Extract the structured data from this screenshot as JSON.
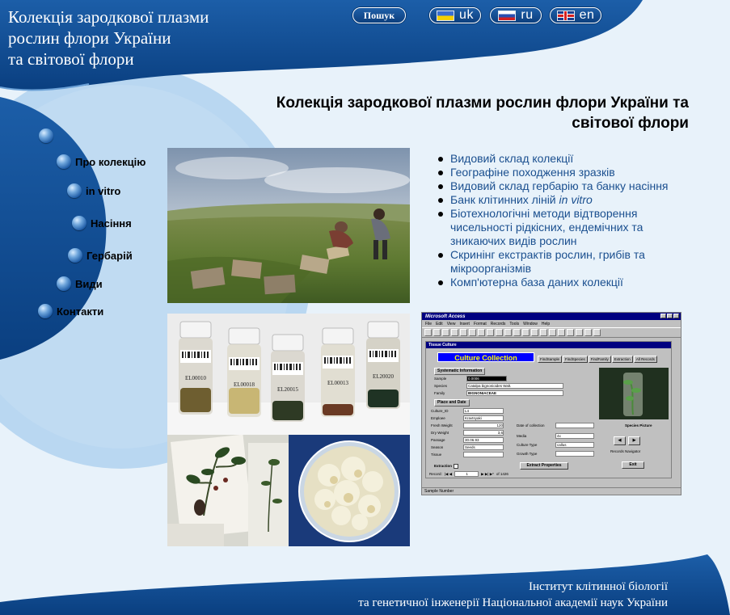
{
  "header": {
    "title_lines": [
      "Колекція зародкової плазми",
      "рослин флори України",
      "та світової флори"
    ],
    "search_label": "Пошук",
    "languages": [
      {
        "code_label": "uk",
        "flag": "ukraine-flag-icon"
      },
      {
        "code_label": "ru",
        "flag": "russia-flag-icon"
      },
      {
        "code_label": "en",
        "flag": "uk-flag-icon"
      }
    ]
  },
  "main": {
    "heading_line1": "Колекція зародкової плазми рослин флори України та",
    "heading_line2": "світової флори"
  },
  "nav": {
    "items": [
      {
        "label": ""
      },
      {
        "label": "Про колекцію"
      },
      {
        "label": "in vitro"
      },
      {
        "label": "Насіння"
      },
      {
        "label": "Гербарій"
      },
      {
        "label": "Види"
      },
      {
        "label": "Контакти"
      }
    ]
  },
  "features": {
    "items": [
      "Видовий склад колекції",
      "Географіне походження зразків",
      "Видовий склад гербарію та банку насіння",
      "Банк клітинних ліній ",
      "Біотехнологічні методи відтворення чисельності рідкісних, ендемічних та зникаючих видів рослин",
      "Скринінг екстрактів рослин, грибів та мікроорганізмів",
      "Комп'ютерна база даних колекції"
    ],
    "item4_italic": "in vitro"
  },
  "images": {
    "vial_labels": [
      "EL00010",
      "EL00018",
      "EL20015",
      "EL00013",
      "EL20020"
    ]
  },
  "access_window": {
    "title": "Microsoft Access",
    "menu": [
      "File",
      "Edit",
      "View",
      "Insert",
      "Format",
      "Records",
      "Tools",
      "Window",
      "Help"
    ],
    "form_title": "Tissue Culture",
    "header_label": "Culture Collection",
    "tabs": [
      "FindSample",
      "FindSpecies",
      "FindFamily",
      "Extraction",
      "All Records"
    ],
    "section_systematic": "Systematic Information",
    "section_place": "Place and Date",
    "fields": {
      "sample_label": "Sample",
      "sample_value": "0.0006",
      "species_label": "Species",
      "species_value": "Catalpa bignonioides Walt.",
      "family_label": "Family",
      "family_value": "BIGNONIACEAE",
      "culture_label": "Culture_ID",
      "culture_value": "L4",
      "employee_label": "Emploee",
      "employee_value": "Kravtsyaki",
      "fresh_label": "Fresh Weight",
      "fresh_value": "120",
      "dry_label": "Dry Weight",
      "dry_value": "3,6",
      "passage_label": "Passage",
      "passage_value": "30.06.93",
      "season_label": "Season",
      "season_value": "Seeds",
      "tissue_label": "Tissue",
      "tissue_value": "",
      "date_label": "Date of collection",
      "media_label": "Media",
      "media_value": "4x",
      "culture_type_label": "Culture Type",
      "culture_type_value": "callus",
      "growth_label": "Growth Type"
    },
    "extraction_label": "Extraction",
    "extract_button": "Extract Properties",
    "species_picture": "Species Picture",
    "records_navigator": "Records Navigator",
    "exit_button": "Exit",
    "record_label": "Record:",
    "record_number": "1",
    "record_total": "of 1426",
    "status": "Sample Number"
  },
  "footer": {
    "line1": "Інститут клітинної біології",
    "line2": "та генетичної інженерії Національної академії наук України"
  },
  "colors": {
    "header_blue": "#0d4b91",
    "light_blue": "#b7d6f0",
    "background": "#e8f2fa",
    "link": "#1a4f8f"
  }
}
